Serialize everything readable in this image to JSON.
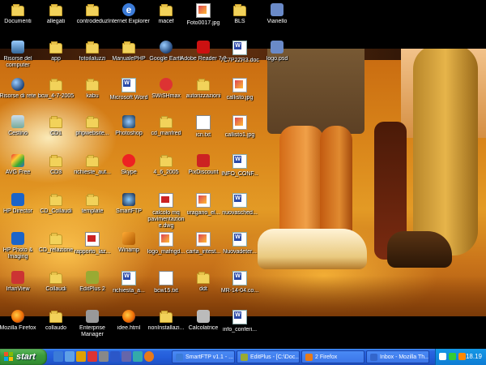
{
  "desktop": {
    "icons": [
      {
        "label": "Documenti",
        "glyph": "documents-folder-icon"
      },
      {
        "label": "allegati",
        "glyph": "folder-icon"
      },
      {
        "label": "controdeduz",
        "glyph": "folder-icon"
      },
      {
        "label": "Internet Explorer",
        "glyph": "internet-explorer-icon"
      },
      {
        "label": "macef",
        "glyph": "folder-icon"
      },
      {
        "label": "Foto0017.jpg",
        "glyph": "image-file-icon"
      },
      {
        "label": "BLS",
        "glyph": "folder-icon"
      },
      {
        "label": "Vianello",
        "glyph": "app-icon"
      },
      {
        "label": "Risorse del computer",
        "glyph": "my-computer-icon"
      },
      {
        "label": "app",
        "glyph": "folder-icon"
      },
      {
        "label": "fotoilaluzzi",
        "glyph": "folder-icon"
      },
      {
        "label": "ManualePHP",
        "glyph": "folder-icon"
      },
      {
        "label": "Google Earth",
        "glyph": "google-earth-icon"
      },
      {
        "label": "Adobe Reader 7.0",
        "glyph": "adobe-reader-icon"
      },
      {
        "label": "7C7P2ZR3.doc",
        "glyph": "word-doc-icon"
      },
      {
        "label": "logo.psd",
        "glyph": "app-icon"
      },
      {
        "label": "Risorse di rete",
        "glyph": "network-icon"
      },
      {
        "label": "bcw_4-7-2005",
        "glyph": "folder-icon"
      },
      {
        "label": "kabu",
        "glyph": "folder-icon"
      },
      {
        "label": "Microsoft Word",
        "glyph": "word-app-icon"
      },
      {
        "label": "SWiSHmax",
        "glyph": "swishmax-icon"
      },
      {
        "label": "autorizzazioni",
        "glyph": "folder-icon"
      },
      {
        "label": "callisto.jpg",
        "glyph": "image-file-icon"
      },
      {
        "label": "Cestino",
        "glyph": "recycle-bin-icon"
      },
      {
        "label": "CD1",
        "glyph": "folder-icon"
      },
      {
        "label": "phpwebsite...",
        "glyph": "folder-icon"
      },
      {
        "label": "Photoshop",
        "glyph": "photoshop-icon"
      },
      {
        "label": "cd_manfred",
        "glyph": "folder-icon"
      },
      {
        "label": "icn.txt",
        "glyph": "text-file-icon"
      },
      {
        "label": "callisto1.jpg",
        "glyph": "image-file-icon"
      },
      {
        "label": "AVG Free",
        "glyph": "avg-icon"
      },
      {
        "label": "CD3",
        "glyph": "folder-icon"
      },
      {
        "label": "richieste_aut...",
        "glyph": "folder-icon"
      },
      {
        "label": "Skype",
        "glyph": "skype-icon"
      },
      {
        "label": "4_6_2005",
        "glyph": "folder-icon"
      },
      {
        "label": "PixDiscount",
        "glyph": "pixdiscount-icon"
      },
      {
        "label": "INFO_CONF...",
        "glyph": "word-doc-icon"
      },
      {
        "label": "HP Director",
        "glyph": "hp-director-icon"
      },
      {
        "label": "CD_Collaudi",
        "glyph": "folder-icon"
      },
      {
        "label": "template",
        "glyph": "folder-icon"
      },
      {
        "label": "SmartFTP",
        "glyph": "smartftp-icon"
      },
      {
        "label": "calcolo mq pavimentazion e.dwg",
        "glyph": "dwg-file-icon"
      },
      {
        "label": "uragano_el...",
        "glyph": "image-file-icon"
      },
      {
        "label": "nuovasched...",
        "glyph": "word-doc-icon"
      },
      {
        "label": "HP Photo & Imaging",
        "glyph": "hp-photo-icon"
      },
      {
        "label": "CD_relazione",
        "glyph": "folder-icon"
      },
      {
        "label": "rapporto_laz...",
        "glyph": "pdf-file-icon"
      },
      {
        "label": "Winamp",
        "glyph": "winamp-icon"
      },
      {
        "label": "logo_mafrigd...",
        "glyph": "image-file-icon"
      },
      {
        "label": "carta_intest...",
        "glyph": "image-file-icon"
      },
      {
        "label": "Nuovadeter...",
        "glyph": "word-doc-icon"
      },
      {
        "label": "IrfanView",
        "glyph": "irfanview-icon"
      },
      {
        "label": "Collaudi",
        "glyph": "folder-icon"
      },
      {
        "label": "EditPlus 2",
        "glyph": "editplus-icon"
      },
      {
        "label": "richiesta_a...",
        "glyph": "word-doc-icon"
      },
      {
        "label": "bcw15.txt",
        "glyph": "text-file-icon"
      },
      {
        "label": "ddt",
        "glyph": "folder-icon"
      },
      {
        "label": "MR-14-04.co...",
        "glyph": "word-doc-icon"
      },
      {
        "label": "Mozilla Firefox",
        "glyph": "firefox-icon"
      },
      {
        "label": "collaudo",
        "glyph": "folder-icon"
      },
      {
        "label": "Enterprise Manager",
        "glyph": "enterprise-manager-icon"
      },
      {
        "label": "idee.html",
        "glyph": "firefox-icon"
      },
      {
        "label": "nonInstallazi...",
        "glyph": "folder-icon"
      },
      {
        "label": "Calcolatrice",
        "glyph": "calculator-icon"
      },
      {
        "label": "info_conferi...",
        "glyph": "word-doc-icon"
      }
    ]
  },
  "taskbar": {
    "start_label": "start",
    "tasks": [
      {
        "label": "SmartFTP v1.1 - ...",
        "icon": "smartftp-icon",
        "active": false
      },
      {
        "label": "EditPlus - [C:\\Doc...",
        "icon": "editplus-icon",
        "active": false
      },
      {
        "label": "2 Firefox",
        "icon": "firefox-icon",
        "active": false
      },
      {
        "label": "Inbox - Mozilla Th...",
        "icon": "thunderbird-icon",
        "active": false
      }
    ],
    "clock": "18.19"
  }
}
